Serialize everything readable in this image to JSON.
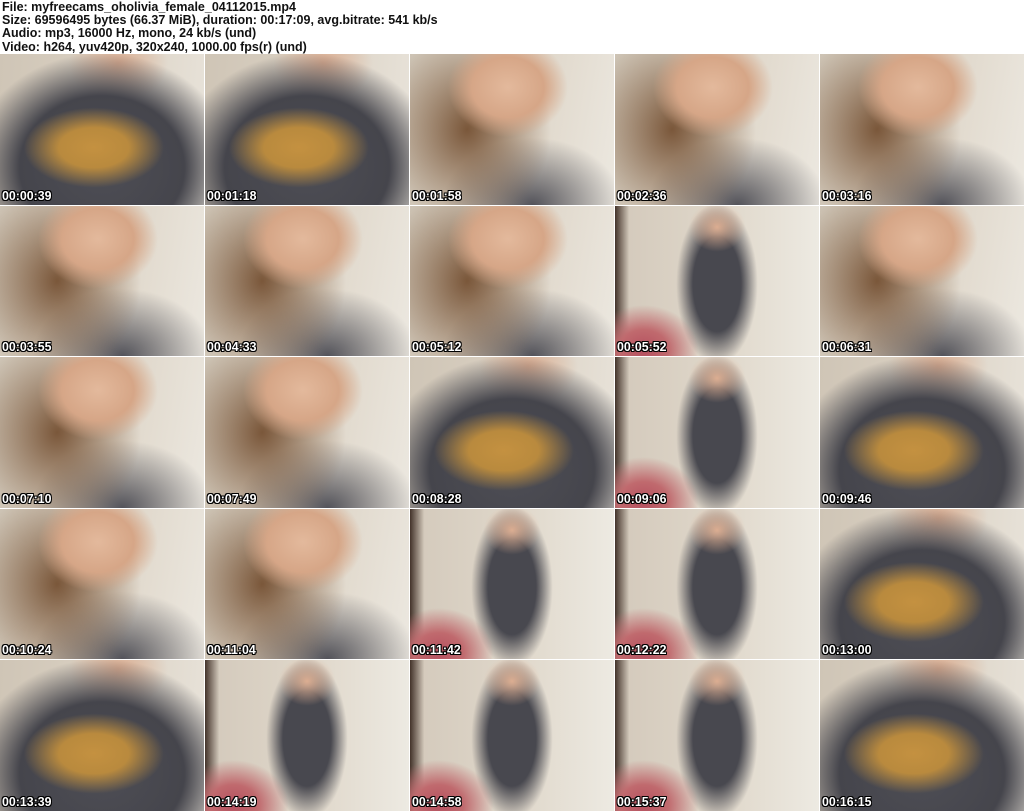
{
  "header": {
    "lines": [
      "File: myfreecams_oholivia_female_04112015.mp4",
      "Size: 69596495 bytes (66.37 MiB), duration: 00:17:09, avg.bitrate: 541 kb/s",
      "Audio: mp3, 16000 Hz, mono, 24 kb/s (und)",
      "Video: h264, yuv420p, 320x240, 1000.00 fps(r) (und)"
    ]
  },
  "thumbnails": [
    {
      "time": "00:00:39"
    },
    {
      "time": "00:01:18"
    },
    {
      "time": "00:01:58"
    },
    {
      "time": "00:02:36"
    },
    {
      "time": "00:03:16"
    },
    {
      "time": "00:03:55"
    },
    {
      "time": "00:04:33"
    },
    {
      "time": "00:05:12"
    },
    {
      "time": "00:05:52"
    },
    {
      "time": "00:06:31"
    },
    {
      "time": "00:07:10"
    },
    {
      "time": "00:07:49"
    },
    {
      "time": "00:08:28"
    },
    {
      "time": "00:09:06"
    },
    {
      "time": "00:09:46"
    },
    {
      "time": "00:10:24"
    },
    {
      "time": "00:11:04"
    },
    {
      "time": "00:11:42"
    },
    {
      "time": "00:12:22"
    },
    {
      "time": "00:13:00"
    },
    {
      "time": "00:13:39"
    },
    {
      "time": "00:14:19"
    },
    {
      "time": "00:14:58"
    },
    {
      "time": "00:15:37"
    },
    {
      "time": "00:16:15"
    }
  ],
  "palette": {
    "background": "#ffffff",
    "header_text": "#111111",
    "timestamp_text": "#ffffff",
    "timestamp_outline": "#000000",
    "wall_cream": "#ded5c8",
    "shirt_gray": "#4a4a50",
    "logo_mustard": "#c49140",
    "skin_warm": "#d9ac90",
    "hair_brown": "#7a573a",
    "blanket_red": "#b5505f",
    "furniture_wood": "#43332a"
  }
}
